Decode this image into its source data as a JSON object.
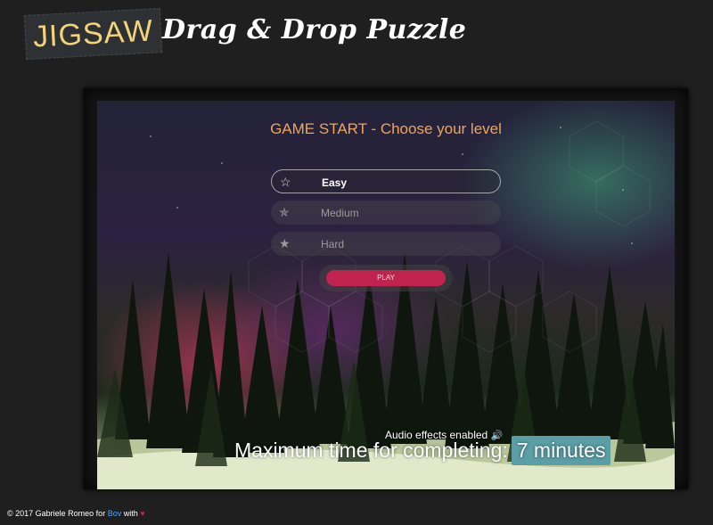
{
  "header": {
    "logo": "JIGSAW",
    "title": "Drag & Drop Puzzle"
  },
  "game": {
    "title": "GAME START - Choose your level",
    "levels": [
      {
        "label": "Easy",
        "icon": "star-outline-icon",
        "selected": true
      },
      {
        "label": "Medium",
        "icon": "star-half-icon",
        "selected": false
      },
      {
        "label": "Hard",
        "icon": "star-full-icon",
        "selected": false
      }
    ],
    "play_label": "PLAY",
    "audio_text": "Audio effects enabled",
    "audio_icon": "speaker-icon",
    "max_time_label": "Maximum time for completing:",
    "max_time_value": "7 minutes"
  },
  "footer": {
    "prefix": "© 2017 Gabriele Romeo for ",
    "brand": "Bov",
    "suffix": " with ",
    "heart": "♥"
  },
  "colors": {
    "background": "#1f1f1f",
    "accent": "#c0234d",
    "title_orange": "#f0a35a",
    "logo_yellow": "#f3d27a",
    "time_badge": "#5a9ea6"
  }
}
